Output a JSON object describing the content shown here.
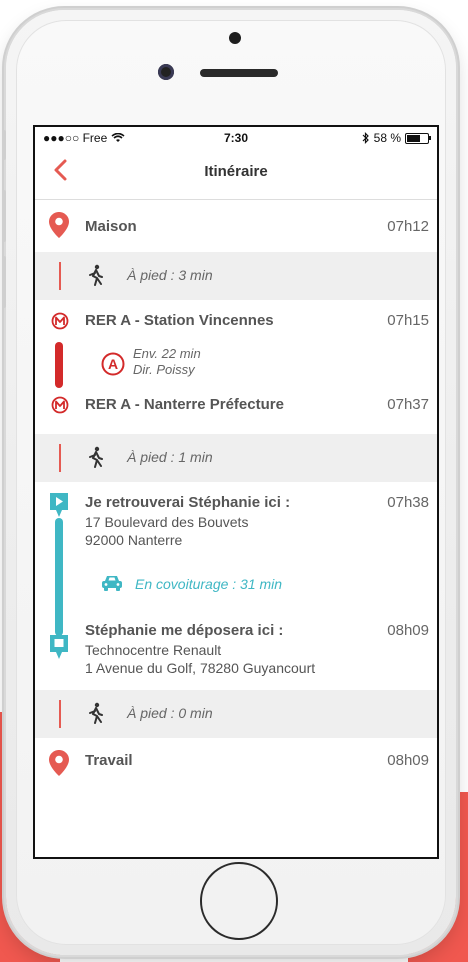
{
  "status_bar": {
    "carrier": "●●●○○ Free",
    "time": "7:30",
    "battery": "58 %"
  },
  "nav": {
    "title": "Itinéraire"
  },
  "itinerary": {
    "start": {
      "label": "Maison",
      "time": "07h12"
    },
    "walk1": {
      "text": "À pied : 3 min"
    },
    "metro_start": {
      "label": "RER A - Station Vincennes",
      "time": "07h15"
    },
    "metro_info": {
      "line": "A",
      "duration": "Env. 22 min",
      "direction": "Dir. Poissy"
    },
    "metro_end": {
      "label": "RER A - Nanterre Préfecture",
      "time": "07h37"
    },
    "walk2": {
      "text": "À pied : 1 min"
    },
    "pickup": {
      "title": "Je retrouverai Stéphanie ici :",
      "time": "07h38",
      "address_line1": "17 Boulevard des Bouvets",
      "address_line2": "92000 Nanterre"
    },
    "carpool": {
      "text": "En covoiturage : 31 min"
    },
    "dropoff": {
      "title": "Stéphanie me déposera ici :",
      "time": "08h09",
      "address_line1": "Technocentre Renault",
      "address_line2": "1 Avenue du Golf, 78280 Guyancourt"
    },
    "walk3": {
      "text": "À pied : 0 min"
    },
    "end": {
      "label": "Travail",
      "time": "08h09"
    }
  },
  "colors": {
    "accent_red": "#e55a52",
    "metro_red": "#d32a2a",
    "carpool_teal": "#3fb7c4"
  },
  "icons": {
    "back": "chevron-left-icon",
    "place": "map-pin-icon",
    "walk": "pedestrian-icon",
    "metro": "metro-icon",
    "rer": "rer-line-icon",
    "car": "car-icon",
    "pickup": "pickup-pin-icon",
    "dropoff": "dropoff-pin-icon"
  }
}
